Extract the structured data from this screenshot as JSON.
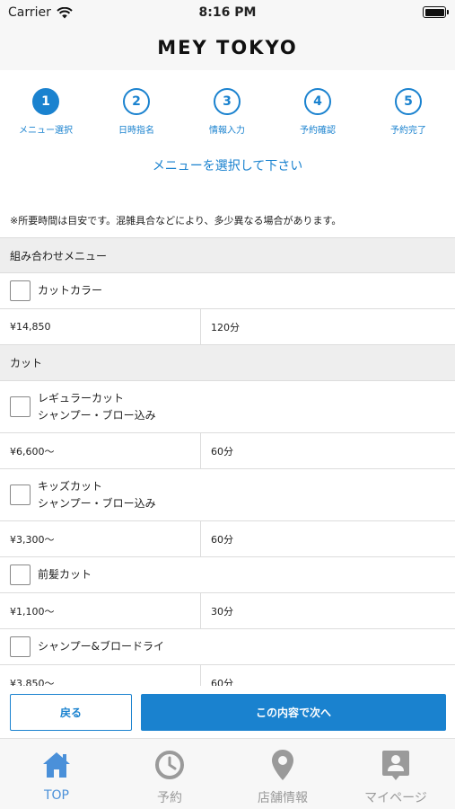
{
  "status_bar": {
    "carrier": "Carrier",
    "time": "8:16 PM"
  },
  "header": {
    "title": "MEY TOKYO"
  },
  "steps": [
    {
      "number": "1",
      "label": "メニュー選択",
      "active": true
    },
    {
      "number": "2",
      "label": "日時指名",
      "active": false
    },
    {
      "number": "3",
      "label": "情報入力",
      "active": false
    },
    {
      "number": "4",
      "label": "予約確認",
      "active": false
    },
    {
      "number": "5",
      "label": "予約完了",
      "active": false
    }
  ],
  "instruction": "メニューを選択して下さい",
  "note": "※所要時間は目安です。混雑具合などにより、多少異なる場合があります。",
  "sections": [
    {
      "title": "組み合わせメニュー",
      "items": [
        {
          "name_lines": [
            "カットカラー"
          ],
          "price": "¥14,850",
          "duration": "120分"
        }
      ]
    },
    {
      "title": "カット",
      "items": [
        {
          "name_lines": [
            "レギュラーカット",
            "シャンプー・ブロー込み"
          ],
          "price": "¥6,600〜",
          "duration": "60分"
        },
        {
          "name_lines": [
            "キッズカット",
            "シャンプー・ブロー込み"
          ],
          "price": "¥3,300〜",
          "duration": "60分"
        },
        {
          "name_lines": [
            "前髪カット"
          ],
          "price": "¥1,100〜",
          "duration": "30分"
        },
        {
          "name_lines": [
            "シャンプー&ブロードライ"
          ],
          "price": "¥3,850〜",
          "duration": "60分"
        }
      ]
    }
  ],
  "actions": {
    "back": "戻る",
    "next": "この内容で次へ"
  },
  "tabs": [
    {
      "label": "TOP",
      "icon": "home-icon",
      "active": true
    },
    {
      "label": "予約",
      "icon": "clock-icon",
      "active": false
    },
    {
      "label": "店舗情報",
      "icon": "location-pin-icon",
      "active": false
    },
    {
      "label": "マイページ",
      "icon": "profile-badge-icon",
      "active": false
    }
  ],
  "colors": {
    "accent": "#1a82cf",
    "tab_active": "#4a90d9",
    "tab_inactive": "#9a9a9a",
    "section_bg": "#eeeeee"
  }
}
